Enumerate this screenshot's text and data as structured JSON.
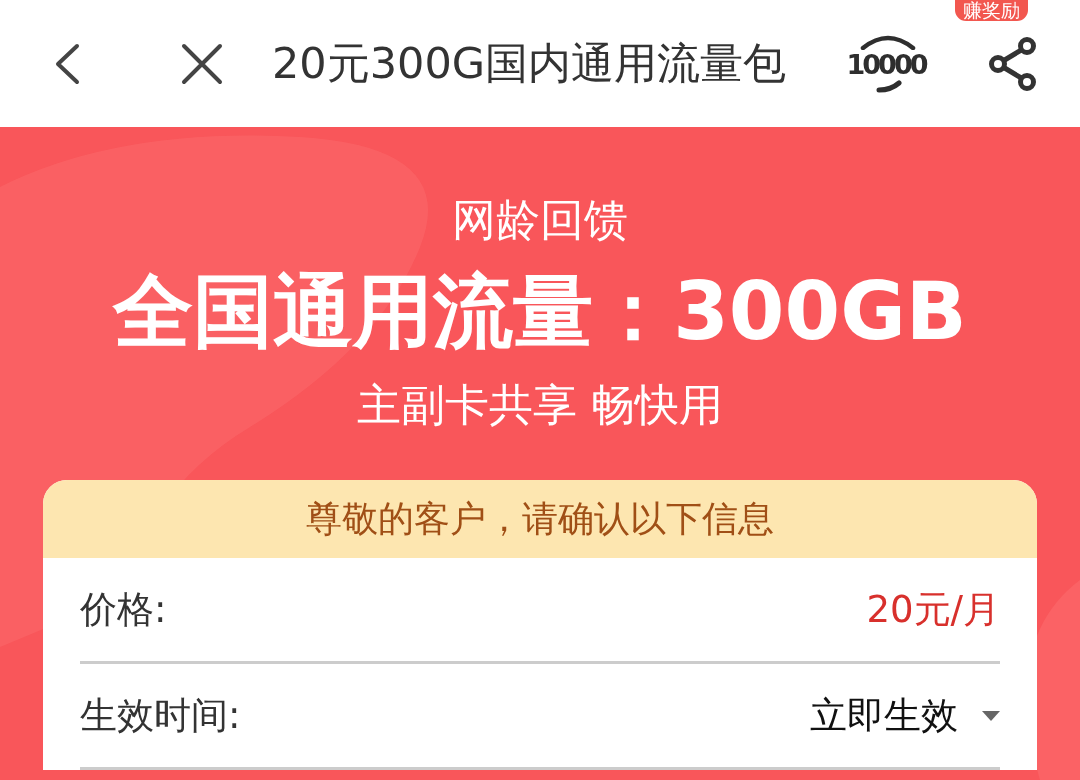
{
  "nav_bar": {
    "title": "20元300G国内通用流量包",
    "service_logo": "10000",
    "share_badge": "赚奖励"
  },
  "banner": {
    "subtitle": "网龄回馈",
    "headline": "全国通用流量：300GB",
    "tagline": "主副卡共享 畅快用"
  },
  "confirm_card": {
    "heading": "尊敬的客户，请确认以下信息",
    "rows": [
      {
        "kind": "price",
        "label": "价格:",
        "value": "20元/月"
      },
      {
        "kind": "select",
        "label": "生效时间:",
        "value": "立即生效"
      }
    ]
  }
}
